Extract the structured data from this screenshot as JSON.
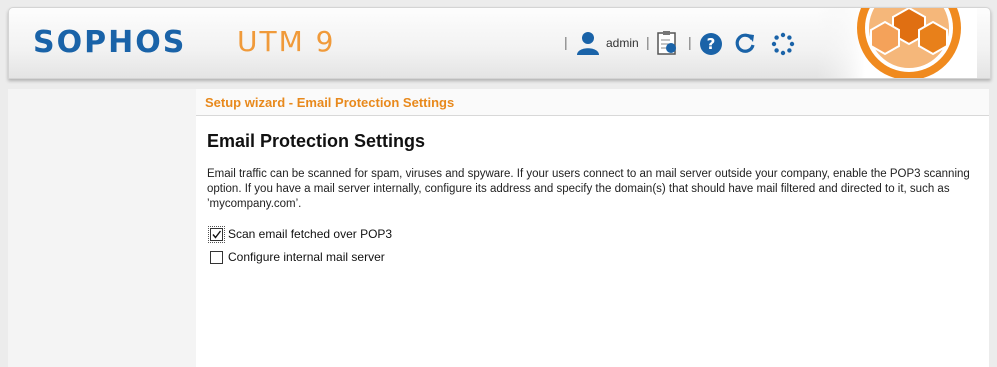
{
  "header": {
    "logo": "SOPHOS",
    "product": "UTM 9",
    "user_label": "admin",
    "separator": "|",
    "icons": [
      "user-icon",
      "report-icon",
      "help-icon",
      "refresh-icon",
      "loading-icon",
      "sophos-badge-icon"
    ],
    "colors": {
      "logo": "#1a63a8",
      "product": "#f09a3a",
      "accent": "#e8891c"
    }
  },
  "wizard": {
    "title": "Setup wizard - Email Protection Settings"
  },
  "content": {
    "heading": "Email Protection Settings",
    "description": "Email traffic can be scanned for spam, viruses and spyware. If your users connect to an mail server outside your company, enable the POP3 scanning option. If you have a mail server internally, configure its address and specify the domain(s) that should have mail filtered and directed to it, such as ’mycompany.com’.",
    "options": [
      {
        "label": "Scan email fetched over POP3",
        "checked": true
      },
      {
        "label": "Configure internal mail server",
        "checked": false
      }
    ]
  }
}
